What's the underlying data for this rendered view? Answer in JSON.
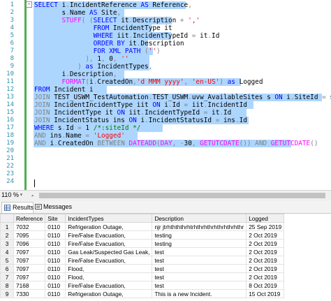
{
  "editor": {
    "line_numbers": [
      "1",
      "2",
      "3",
      "4",
      "5",
      "6",
      "7",
      "8",
      "9",
      "10",
      "11",
      "12",
      "13",
      "14",
      "15",
      "16",
      "17",
      "18",
      "19",
      "20",
      "21",
      "22",
      "23",
      "24"
    ],
    "lines": [
      [
        {
          "c": "kw",
          "t": "SELECT "
        },
        {
          "c": "id",
          "t": "i"
        },
        {
          "c": "op",
          "t": "."
        },
        {
          "c": "id",
          "t": "IncidentReference "
        },
        {
          "c": "kw",
          "t": "AS "
        },
        {
          "c": "id",
          "t": "Reference"
        },
        {
          "c": "op",
          "t": ","
        }
      ],
      [
        {
          "c": "id",
          "t": "       s"
        },
        {
          "c": "op",
          "t": "."
        },
        {
          "c": "id",
          "t": "Name "
        },
        {
          "c": "kw",
          "t": "AS "
        },
        {
          "c": "id",
          "t": "Site"
        },
        {
          "c": "op",
          "t": ","
        }
      ],
      [
        {
          "c": "fn",
          "t": "       STUFF"
        },
        {
          "c": "op",
          "t": "( ("
        },
        {
          "c": "kw",
          "t": "SELECT "
        },
        {
          "c": "id",
          "t": "it"
        },
        {
          "c": "op",
          "t": "."
        },
        {
          "c": "id",
          "t": "Description "
        },
        {
          "c": "op",
          "t": "+ "
        },
        {
          "c": "str",
          "t": "','"
        }
      ],
      [
        {
          "c": "kw",
          "t": "               FROM "
        },
        {
          "c": "id",
          "t": "IncidentType it"
        }
      ],
      [
        {
          "c": "kw",
          "t": "               WHERE "
        },
        {
          "c": "id",
          "t": "iit"
        },
        {
          "c": "op",
          "t": "."
        },
        {
          "c": "id",
          "t": "IncidentTypeId "
        },
        {
          "c": "op",
          "t": "= "
        },
        {
          "c": "id",
          "t": "it"
        },
        {
          "c": "op",
          "t": "."
        },
        {
          "c": "id",
          "t": "Id"
        }
      ],
      [
        {
          "c": "kw",
          "t": "               ORDER BY "
        },
        {
          "c": "id",
          "t": "it"
        },
        {
          "c": "op",
          "t": "."
        },
        {
          "c": "id",
          "t": "Description"
        }
      ],
      [
        {
          "c": "kw",
          "t": "               FOR XML PATH "
        },
        {
          "c": "op",
          "t": "("
        },
        {
          "c": "str",
          "t": "''"
        },
        {
          "c": "op",
          "t": ")"
        }
      ],
      [
        {
          "c": "op",
          "t": "             ), "
        },
        {
          "c": "id",
          "t": "1"
        },
        {
          "c": "op",
          "t": ", "
        },
        {
          "c": "id",
          "t": "0"
        },
        {
          "c": "op",
          "t": ", "
        },
        {
          "c": "str",
          "t": "''"
        }
      ],
      [
        {
          "c": "op",
          "t": "           ) "
        },
        {
          "c": "kw",
          "t": "as "
        },
        {
          "c": "id",
          "t": "IncidentTypes"
        },
        {
          "c": "op",
          "t": ","
        }
      ],
      [
        {
          "c": "id",
          "t": "       i"
        },
        {
          "c": "op",
          "t": "."
        },
        {
          "c": "id",
          "t": "Description"
        },
        {
          "c": "op",
          "t": ","
        }
      ],
      [
        {
          "c": "fn",
          "t": "       FORMAT"
        },
        {
          "c": "op",
          "t": "("
        },
        {
          "c": "id",
          "t": "i"
        },
        {
          "c": "op",
          "t": "."
        },
        {
          "c": "id",
          "t": "CreatedOn"
        },
        {
          "c": "op",
          "t": ","
        },
        {
          "c": "str",
          "t": "'d MMM yyyy'"
        },
        {
          "c": "op",
          "t": ", "
        },
        {
          "c": "str",
          "t": "'en-US'"
        },
        {
          "c": "op",
          "t": ") "
        },
        {
          "c": "kw",
          "t": "as "
        },
        {
          "c": "id",
          "t": "Logged"
        }
      ],
      [
        {
          "c": "kw",
          "t": "FROM "
        },
        {
          "c": "id",
          "t": "Incident i"
        }
      ],
      [
        {
          "c": "op",
          "t": "JOIN "
        },
        {
          "c": "id",
          "t": "TEST_USWM_TestAutomation"
        },
        {
          "c": "op",
          "t": "."
        },
        {
          "c": "id",
          "t": "TEST_USWM"
        },
        {
          "c": "op",
          "t": "."
        },
        {
          "c": "id",
          "t": "uvw_AvailableSites s "
        },
        {
          "c": "kw",
          "t": "ON "
        },
        {
          "c": "id",
          "t": "i"
        },
        {
          "c": "op",
          "t": "."
        },
        {
          "c": "id",
          "t": "SiteId "
        },
        {
          "c": "op",
          "t": "= "
        },
        {
          "c": "id",
          "t": "s"
        },
        {
          "c": "op",
          "t": "."
        },
        {
          "c": "id",
          "t": "Id"
        }
      ],
      [
        {
          "c": "op",
          "t": "JOIN "
        },
        {
          "c": "id",
          "t": "IncidentIncidentType iit "
        },
        {
          "c": "kw",
          "t": "ON "
        },
        {
          "c": "id",
          "t": "i"
        },
        {
          "c": "op",
          "t": "."
        },
        {
          "c": "id",
          "t": "Id "
        },
        {
          "c": "op",
          "t": "= "
        },
        {
          "c": "id",
          "t": "iit"
        },
        {
          "c": "op",
          "t": "."
        },
        {
          "c": "id",
          "t": "IncidentId"
        }
      ],
      [
        {
          "c": "op",
          "t": "JOIN "
        },
        {
          "c": "id",
          "t": "IncidentType it "
        },
        {
          "c": "kw",
          "t": "ON "
        },
        {
          "c": "id",
          "t": "iit"
        },
        {
          "c": "op",
          "t": "."
        },
        {
          "c": "id",
          "t": "IncidentTypeId "
        },
        {
          "c": "op",
          "t": "= "
        },
        {
          "c": "id",
          "t": "it"
        },
        {
          "c": "op",
          "t": "."
        },
        {
          "c": "id",
          "t": "Id"
        }
      ],
      [
        {
          "c": "op",
          "t": "JOIN "
        },
        {
          "c": "id",
          "t": "IncidentStatus ins "
        },
        {
          "c": "kw",
          "t": "ON "
        },
        {
          "c": "id",
          "t": "i"
        },
        {
          "c": "op",
          "t": "."
        },
        {
          "c": "id",
          "t": "IncidentStatusId "
        },
        {
          "c": "op",
          "t": "= "
        },
        {
          "c": "id",
          "t": "ins"
        },
        {
          "c": "op",
          "t": "."
        },
        {
          "c": "id",
          "t": "Id"
        }
      ],
      [
        {
          "c": "kw",
          "t": "WHERE "
        },
        {
          "c": "id",
          "t": "s"
        },
        {
          "c": "op",
          "t": "."
        },
        {
          "c": "id",
          "t": "Id "
        },
        {
          "c": "op",
          "t": "= "
        },
        {
          "c": "id",
          "t": "1 "
        },
        {
          "c": "cm",
          "t": "/*:siteId */"
        }
      ],
      [
        {
          "c": "op",
          "t": "AND "
        },
        {
          "c": "id",
          "t": "ins"
        },
        {
          "c": "op",
          "t": "."
        },
        {
          "c": "id",
          "t": "Name "
        },
        {
          "c": "op",
          "t": "= "
        },
        {
          "c": "str",
          "t": "'Logged'"
        }
      ],
      [
        {
          "c": "op",
          "t": "AND "
        },
        {
          "c": "id",
          "t": "i"
        },
        {
          "c": "op",
          "t": "."
        },
        {
          "c": "id",
          "t": "CreatedOn "
        },
        {
          "c": "op",
          "t": "BETWEEN "
        },
        {
          "c": "fn",
          "t": "DATEADD"
        },
        {
          "c": "op",
          "t": "("
        },
        {
          "c": "fn",
          "t": "DAY"
        },
        {
          "c": "op",
          "t": ", -"
        },
        {
          "c": "id",
          "t": "30"
        },
        {
          "c": "op",
          "t": ", "
        },
        {
          "c": "fn",
          "t": "GETUTCDATE"
        },
        {
          "c": "op",
          "t": "()) AND "
        },
        {
          "c": "fn",
          "t": "GETUTCDATE"
        },
        {
          "c": "op",
          "t": "()"
        }
      ],
      [],
      [],
      [],
      [],
      []
    ]
  },
  "status": {
    "zoom": "110 %"
  },
  "tabs": [
    {
      "label": "Results",
      "icon": "grid-icon"
    },
    {
      "label": "Messages",
      "icon": "messages-icon"
    }
  ],
  "grid": {
    "columns": [
      "Reference",
      "Site",
      "IncidentTypes",
      "Description",
      "Logged"
    ],
    "rows": [
      [
        "1",
        "7032",
        "0110",
        "Refrigeration Outage,",
        "njr jtrhthththrhtrhthrhthrhthrhthrhthr",
        "25 Sep 2019"
      ],
      [
        "2",
        "7095",
        "0110",
        "Fire/False Evacuation,",
        "testing",
        "2 Oct 2019"
      ],
      [
        "3",
        "7096",
        "0110",
        "Fire/False Evacuation,",
        "testing",
        "2 Oct 2019"
      ],
      [
        "4",
        "7097",
        "0110",
        "Gas Leak/Suspected Gas Leak,",
        "test",
        "2 Oct 2019"
      ],
      [
        "5",
        "7097",
        "0110",
        "Fire/False Evacuation,",
        "test",
        "2 Oct 2019"
      ],
      [
        "6",
        "7097",
        "0110",
        "Flood,",
        "test",
        "2 Oct 2019"
      ],
      [
        "7",
        "7097",
        "0110",
        "Flood,",
        "test",
        "2 Oct 2019"
      ],
      [
        "8",
        "7168",
        "0110",
        "Fire/False Evacuation,",
        "test",
        "8 Oct 2019"
      ],
      [
        "9",
        "7330",
        "0110",
        "Refrigeration Outage,",
        "This is a new Incident.",
        "15 Oct 2019"
      ]
    ]
  }
}
